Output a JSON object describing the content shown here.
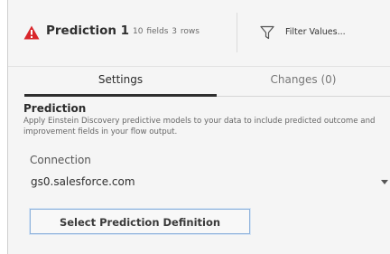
{
  "header": {
    "warning_icon": "warning-triangle-icon",
    "warning_color": "#d9262b",
    "step_name": "Prediction 1",
    "fields_count": "10 fields",
    "rows_count": "3 rows",
    "filter_icon": "filter-funnel-icon",
    "filter_label": "Filter Values..."
  },
  "tabs": [
    {
      "label": "Settings",
      "active": true
    },
    {
      "label": "Changes (0)",
      "active": false
    }
  ],
  "settings": {
    "title": "Prediction",
    "description": "Apply Einstein Discovery predictive models to your data to include predicted outcome and improvement fields in your flow output.",
    "connection": {
      "label": "Connection",
      "value": "gs0.salesforce.com",
      "dropdown_icon": "chevron-down-icon"
    },
    "select_button_label": "Select Prediction Definition"
  }
}
